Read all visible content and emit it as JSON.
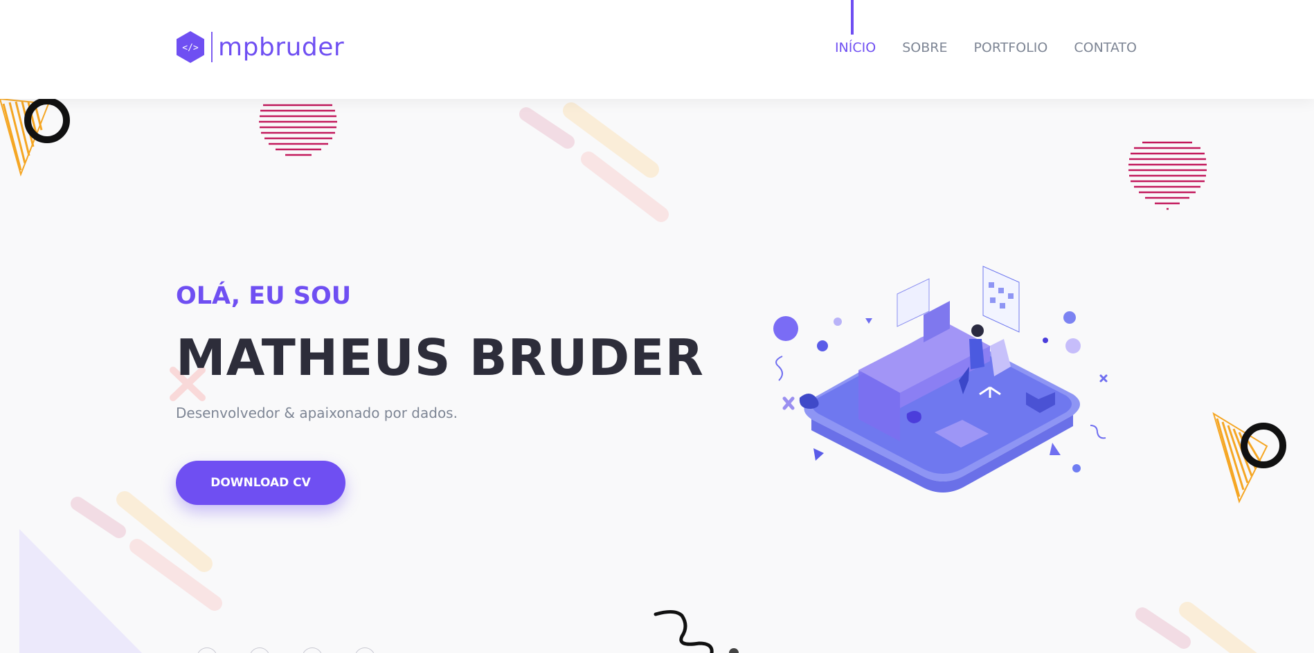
{
  "brand": {
    "logo_text": "mpbruder",
    "logo_glyph": "</>"
  },
  "nav": {
    "items": [
      {
        "label": "INÍCIO",
        "active": true
      },
      {
        "label": "SOBRE",
        "active": false
      },
      {
        "label": "PORTFOLIO",
        "active": false
      },
      {
        "label": "CONTATO",
        "active": false
      }
    ]
  },
  "hero": {
    "kicker": "OLÁ, EU SOU",
    "name": "MATHEUS BRUDER",
    "subtitle": "Desenvolvedor & apaixonado por dados.",
    "cta_label": "DOWNLOAD CV"
  },
  "colors": {
    "accent": "#6f4ff2",
    "title": "#2d2d3a",
    "muted": "#7d8594",
    "stripe_pink": "#c2185b",
    "stripe_orange": "#f5a623"
  },
  "icons": [
    "code-hex-icon",
    "developer-desk-illustration"
  ]
}
